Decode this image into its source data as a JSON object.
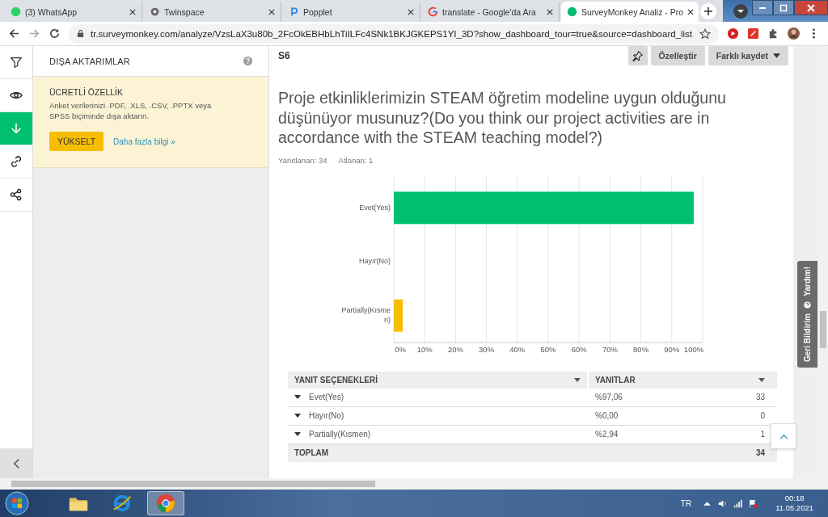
{
  "browser": {
    "tabs": [
      {
        "kind": "whatsapp",
        "title": "(3) WhatsApp",
        "selected": false
      },
      {
        "kind": "twinspace",
        "title": "Twinspace",
        "selected": false
      },
      {
        "kind": "popplet",
        "title": "Popplet",
        "selected": false
      },
      {
        "kind": "google",
        "title": "translate - Google'da Ara",
        "selected": false
      },
      {
        "kind": "surveymonkey",
        "title": "SurveyMonkey Analiz - Pro",
        "selected": true
      }
    ],
    "address": "tr.surveymonkey.com/analyze/VzsLaX3u80b_2FcOkEBHbLhTiILFc4SNk1BKJGKEPS1YI_3D?show_dashboard_tour=true&source=dashboard_list"
  },
  "sidebar": {
    "rail": [
      {
        "kind": "filter",
        "selected": false
      },
      {
        "kind": "eye",
        "selected": false
      },
      {
        "kind": "download",
        "selected": true
      },
      {
        "kind": "link",
        "selected": false
      },
      {
        "kind": "share",
        "selected": false
      }
    ],
    "panel_title": "DIŞA AKTARIMLAR",
    "promo": {
      "title": "ÜCRETLİ ÖZELLİK",
      "text": "Anket verilerinizi .PDF, .XLS, .CSV, .PPTX veya SPSS biçiminde dışa aktarın.",
      "button": "YÜKSELT",
      "link": "Daha fazla bilgi »"
    }
  },
  "question": {
    "number": "S6",
    "buttons": [
      "Özelleştir",
      "Farklı kaydet"
    ],
    "text": "Proje etkinliklerimizin  STEAM öğretim modeline uygun olduğunu düşünüyor musunuz?(Do you think our project activities are in accordance with the STEAM teaching model?)",
    "answered": "Yanıtlanan: 34",
    "skipped": "Atlanan: 1",
    "chart_data": {
      "type": "bar",
      "orientation": "horizontal",
      "categories": [
        "Evet(Yes)",
        "Hayır(No)",
        "Partially(Kısmen)"
      ],
      "values": [
        97.1,
        0,
        2.9
      ],
      "colors": [
        "#00bf6f",
        null,
        "#f7bd00"
      ],
      "grid": true,
      "xlim": [
        0,
        100
      ],
      "xticks": [
        {
          "value": 0,
          "label": "0%"
        },
        {
          "value": 10,
          "label": "10%"
        },
        {
          "value": 20,
          "label": "20%"
        },
        {
          "value": 30,
          "label": "30%"
        },
        {
          "value": 40,
          "label": "40%"
        },
        {
          "value": 50,
          "label": "50%"
        },
        {
          "value": 60,
          "label": "60%"
        },
        {
          "value": 70,
          "label": "70%"
        },
        {
          "value": 80,
          "label": "80%"
        },
        {
          "value": 90,
          "label": "90%"
        },
        {
          "value": 100,
          "label": "100%"
        }
      ]
    }
  },
  "table": {
    "columns": [
      "YANIT SEÇENEKLERİ",
      "YANITLAR"
    ],
    "rows": [
      {
        "choice": "Evet(Yes)",
        "percent": "%97,06",
        "count": "33"
      },
      {
        "choice": "Hayır(No)",
        "percent": "%0,00",
        "count": "0"
      },
      {
        "choice": "Partially(Kısmen)",
        "percent": "%2,94",
        "count": "1"
      }
    ],
    "total": {
      "label": "TOPLAM",
      "count": "34"
    }
  },
  "feedback_tab": [
    "Geri Bildirim",
    "Yardım!"
  ],
  "taskbar": {
    "apps": [
      {
        "kind": "folder",
        "selected": false
      },
      {
        "kind": "ie",
        "selected": false
      },
      {
        "kind": "chrome",
        "selected": true
      }
    ],
    "language": "TR",
    "time": "00:18",
    "date": "11.05.2021"
  }
}
